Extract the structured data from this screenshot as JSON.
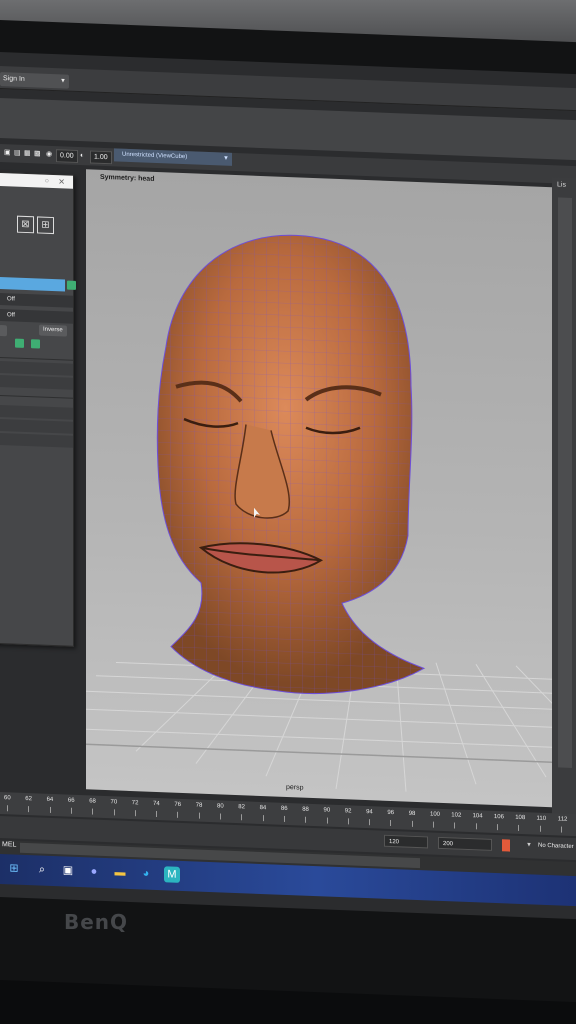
{
  "account": {
    "sign_in": "Sign In"
  },
  "toolbar": {
    "value_a": "0.00",
    "value_b": "1.00",
    "camera_label": "Unrestricted (ViewCube)"
  },
  "viewport": {
    "symmetry": "Symmetry: head",
    "camera": "persp"
  },
  "right_panel": {
    "label": "Lis"
  },
  "tool_panel": {
    "row_off_1": "Off",
    "row_off_2": "Off",
    "inverse_button": "Inverse"
  },
  "timeline": {
    "ticks": [
      "60",
      "62",
      "64",
      "66",
      "68",
      "70",
      "72",
      "74",
      "76",
      "78",
      "80",
      "82",
      "84",
      "86",
      "88",
      "90",
      "92",
      "94",
      "96",
      "98",
      "100",
      "102",
      "104",
      "106",
      "108",
      "110",
      "112"
    ],
    "end_frame": "120",
    "max_frame": "200",
    "character_set": "No Character"
  },
  "command_line": {
    "label": "MEL"
  },
  "monitor": {
    "brand": "BenQ"
  },
  "colors": {
    "accent": "#5aa8e0",
    "taskbar": "#2a4a9a",
    "mesh_wire": "#6d4fd8"
  }
}
